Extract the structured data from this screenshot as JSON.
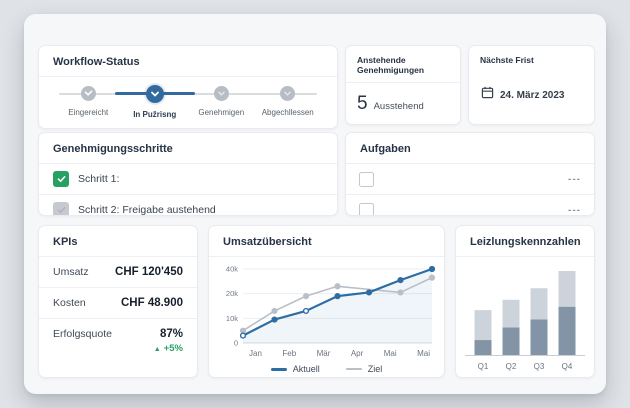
{
  "colors": {
    "accent_blue": "#336a9e",
    "success_green": "#27a163",
    "line_actual": "#2e6da4",
    "line_target": "#b9bfc7",
    "bar_dark": "#8294a6",
    "bar_light": "#cdd3db"
  },
  "workflow": {
    "title": "Workflow-Status",
    "steps": [
      {
        "label": "Eingereicht",
        "state": "done"
      },
      {
        "label": "In Pužrisng",
        "state": "active"
      },
      {
        "label": "Genehmigen",
        "state": "pending"
      },
      {
        "label": "Abgechllessen",
        "state": "pending"
      }
    ]
  },
  "approvals": {
    "title": "Anstehende Genehmigungen",
    "count": "5",
    "label": "Ausstehend"
  },
  "deadline": {
    "title": "Nächste Frist",
    "date": "24. März 2023"
  },
  "approval_steps": {
    "title": "Genehmigungsschritte",
    "items": [
      {
        "label": "Schritt 1:",
        "checked": true
      },
      {
        "label": "Schritt 2: Freigabe austehend",
        "checked": false
      }
    ]
  },
  "tasks": {
    "title": "Aufgaben",
    "items": [
      {
        "menu": "---"
      },
      {
        "menu": "---"
      }
    ]
  },
  "kpis": {
    "title": "KPIs",
    "rows": [
      {
        "label": "Umsatz",
        "value": "CHF 120'450"
      },
      {
        "label": "Kosten",
        "value": "CHF 48.900"
      },
      {
        "label": "Erfolgsquote",
        "value": "87%"
      }
    ],
    "delta": "+5%",
    "delta_icon": "▲"
  },
  "chart_data": [
    {
      "type": "line",
      "title": "Umsatzübersicht",
      "x_labels": [
        "Jan",
        "Feb",
        "Mär",
        "Apr",
        "Mai",
        "Mai"
      ],
      "y_ticks": [
        0,
        10,
        20,
        40
      ],
      "y_tick_labels": [
        "0",
        "10k",
        "20k",
        "40k"
      ],
      "x_range": [
        0,
        6
      ],
      "unit": "k",
      "grid": true,
      "legend_position": "bottom",
      "series": [
        {
          "name": "Aktuell",
          "color": "#2e6da4",
          "width": 2.2,
          "points": [
            [
              0,
              3
            ],
            [
              1,
              9.5
            ],
            [
              2,
              13
            ],
            [
              3,
              19
            ],
            [
              4,
              21
            ],
            [
              5,
              31
            ],
            [
              6,
              40
            ]
          ]
        },
        {
          "name": "Ziel",
          "color": "#b9bfc7",
          "width": 1.6,
          "points": [
            [
              0,
              5
            ],
            [
              1,
              13
            ],
            [
              2,
              19
            ],
            [
              3,
              26
            ],
            [
              5,
              21
            ],
            [
              6,
              33
            ]
          ]
        }
      ]
    },
    {
      "type": "stacked-bar",
      "title": "Leizlungskennzahlen",
      "categories": [
        "Q1",
        "Q2",
        "Q3",
        "Q4"
      ],
      "series": [
        {
          "name": "bottom-segment",
          "color": "#8294a6",
          "values": [
            13,
            24,
            31,
            42
          ]
        },
        {
          "name": "top-segment",
          "color": "#cdd3db",
          "values": [
            26,
            24,
            27,
            31
          ]
        }
      ],
      "ylabel": "",
      "xlabel": "",
      "grid": false
    }
  ]
}
